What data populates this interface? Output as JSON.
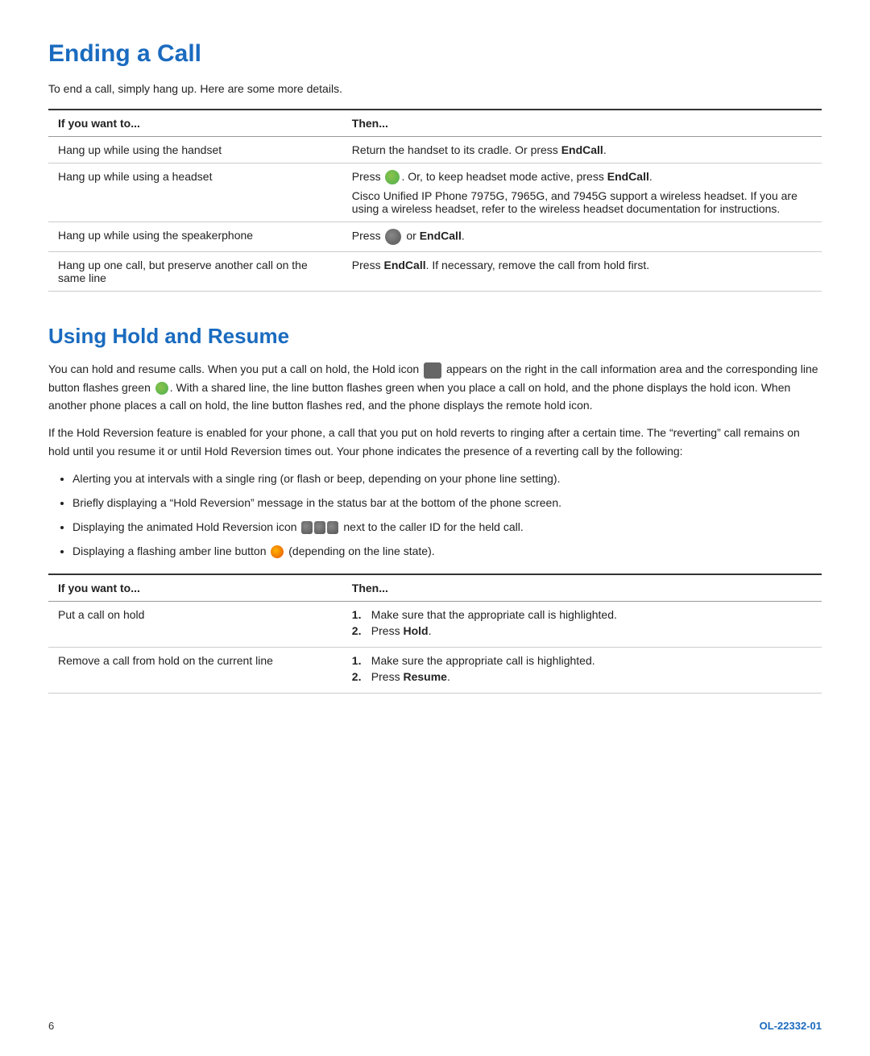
{
  "section1": {
    "title": "Ending a Call",
    "intro": "To end a call, simply hang up. Here are some more details.",
    "table": {
      "col1_header": "If you want to...",
      "col2_header": "Then...",
      "rows": [
        {
          "col1": "Hang up while using the handset",
          "col2_text": "Return the handset to its cradle. Or press ",
          "col2_bold": "EndCall",
          "col2_suffix": ".",
          "type": "simple_bold"
        },
        {
          "col1": "Hang up while using a headset",
          "col2_line1_pre": "Press ",
          "col2_line1_icon": "headset",
          "col2_line1_mid": ". Or, to keep headset mode active, press ",
          "col2_line1_bold": "EndCall",
          "col2_line1_suffix": ".",
          "col2_line2": "Cisco Unified IP Phone 7975G, 7965G, and 7945G support a wireless headset. If you are using a wireless headset, refer to the wireless headset documentation for instructions.",
          "type": "headset"
        },
        {
          "col1": "Hang up while using the speakerphone",
          "col2_pre": "Press ",
          "col2_icon": "speakerphone",
          "col2_mid": " or ",
          "col2_bold": "EndCall",
          "col2_suffix": ".",
          "type": "speakerphone"
        },
        {
          "col1_line1": "Hang up one call, but preserve another",
          "col1_line2": "call on the same line",
          "col2_pre": "Press ",
          "col2_bold": "EndCall",
          "col2_suffix": ". If necessary, remove the call from hold first.",
          "type": "endcall_hold"
        }
      ]
    }
  },
  "section2": {
    "title": "Using Hold and Resume",
    "para1_parts": [
      "You can hold and resume calls. When you put a call on hold, the Hold icon ",
      " appears on the right in the call information area and the corresponding line button flashes green ",
      ". With a shared line, the line button flashes green when you place a call on hold, and the phone displays the hold icon. When another phone places a call on hold, the line button flashes red, and the phone displays the remote hold icon."
    ],
    "para2": "If the Hold Reversion feature is enabled for your phone, a call that you put on hold reverts to ringing after a certain time. The “reverting” call remains on hold until you resume it or until Hold Reversion times out. Your phone indicates the presence of a reverting call by the following:",
    "bullets": [
      "Alerting you at intervals with a single ring (or flash or beep, depending on your phone line setting).",
      "Briefly displaying a “Hold Reversion” message in the status bar at the bottom of the phone screen.",
      "Displaying the animated Hold Reversion icon      next to the caller ID for the held call.",
      "Displaying a flashing amber line button   (depending on the line state)."
    ],
    "table": {
      "col1_header": "If you want to...",
      "col2_header": "Then...",
      "rows": [
        {
          "col1": "Put a call on hold",
          "steps": [
            {
              "num": "1.",
              "text_pre": "Make sure that the appropriate call is highlighted."
            },
            {
              "num": "2.",
              "text_pre": "Press ",
              "text_bold": "Hold",
              "text_suffix": "."
            }
          ]
        },
        {
          "col1_line1": "Remove a call from",
          "col1_line2": "hold on the current line",
          "steps": [
            {
              "num": "1.",
              "text_pre": "Make sure the appropriate call is highlighted."
            },
            {
              "num": "2.",
              "text_pre": "Press ",
              "text_bold": "Resume",
              "text_suffix": "."
            }
          ]
        }
      ]
    }
  },
  "footer": {
    "page_number": "6",
    "doc_id": "OL-22332-01"
  }
}
